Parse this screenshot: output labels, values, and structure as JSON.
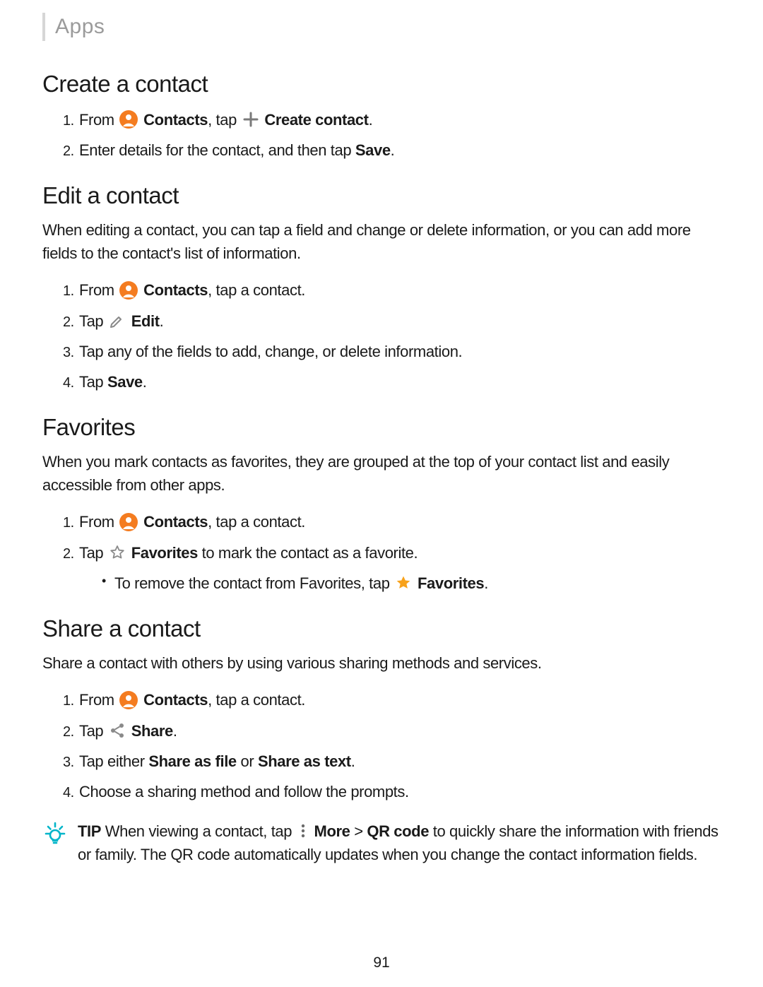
{
  "breadcrumb": "Apps",
  "page_number": "91",
  "sections": {
    "create": {
      "title": "Create a contact",
      "step1_from": "From",
      "step1_contacts": " Contacts",
      "step1_tap": ", tap",
      "step1_create": " Create contact",
      "step1_period": ".",
      "step2_a": "Enter details for the contact, and then tap ",
      "step2_b": "Save",
      "step2_c": "."
    },
    "edit": {
      "title": "Edit a contact",
      "intro": "When editing a contact, you can tap a field and change or delete information, or you can add more fields to the contact's list of information.",
      "step1_from": "From",
      "step1_contacts": " Contacts",
      "step1_rest": ", tap a contact.",
      "step2_tap": "Tap",
      "step2_edit": " Edit",
      "step2_period": ".",
      "step3": "Tap any of the fields to add, change, or delete information.",
      "step4_a": "Tap ",
      "step4_b": "Save",
      "step4_c": "."
    },
    "favorites": {
      "title": "Favorites",
      "intro": "When you mark contacts as favorites, they are grouped at the top of your contact list and easily accessible from other apps.",
      "step1_from": "From",
      "step1_contacts": " Contacts",
      "step1_rest": ", tap a contact.",
      "step2_tap": "Tap",
      "step2_fav": " Favorites",
      "step2_rest": " to mark the contact as a favorite.",
      "sub_a": "To remove the contact from Favorites, tap",
      "sub_fav": " Favorites",
      "sub_period": "."
    },
    "share": {
      "title": "Share a contact",
      "intro": "Share a contact with others by using various sharing methods and services.",
      "step1_from": "From",
      "step1_contacts": " Contacts",
      "step1_rest": ", tap a contact.",
      "step2_tap": "Tap",
      "step2_share": " Share",
      "step2_period": ".",
      "step3_a": "Tap either ",
      "step3_b": "Share as file",
      "step3_c": " or ",
      "step3_d": "Share as text",
      "step3_e": ".",
      "step4": "Choose a sharing method and follow the prompts."
    },
    "tip": {
      "label": "TIP",
      "a": "  When viewing a contact, tap",
      "more": " More",
      "gt": " > ",
      "qr": "QR code",
      "rest": " to quickly share the information with friends or family. The QR code automatically updates when you change the contact information fields."
    }
  }
}
